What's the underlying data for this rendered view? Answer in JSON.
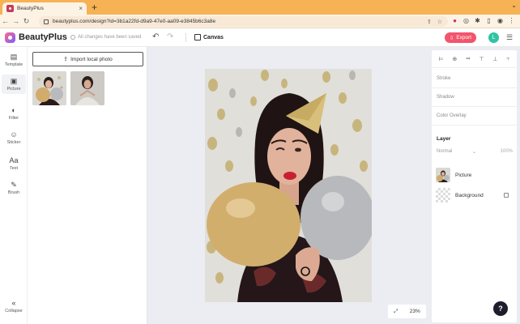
{
  "browser": {
    "tab_title": "BeautyPlus",
    "tab_close": "×",
    "new_tab": "+",
    "url": "beautyplus.com/design?id=3b1a22fd-d9a9-47e0-aa09-e3845b6c3a8e",
    "window_controls": "⌄"
  },
  "header": {
    "brand": "BeautyPlus",
    "save_status": "All changes have been saved",
    "canvas_label": "Canvas",
    "export_label": "Export",
    "avatar_letter": "L",
    "accent": "#f2556c"
  },
  "rail": {
    "items": [
      {
        "label": "Template",
        "icon": "▤"
      },
      {
        "label": "Picture",
        "icon": "▣"
      },
      {
        "label": "Filter",
        "icon": "◐"
      },
      {
        "label": "Sticker",
        "icon": "☺"
      },
      {
        "label": "Text",
        "icon": "Aa"
      },
      {
        "label": "Brush",
        "icon": "✎"
      }
    ],
    "collapse_icon": "«",
    "collapse_label": "Collapse"
  },
  "panel": {
    "import_label": "Import local photo"
  },
  "canvas": {
    "zoom": "23%",
    "fit_icon": "⤢"
  },
  "properties": {
    "align_icons": [
      "⊨",
      "⊕",
      "⫤",
      "⊤",
      "⊥",
      "⫟"
    ],
    "stroke": "Stroke",
    "shadow": "Shadow",
    "color_overlay": "Color Overlay",
    "layer_title": "Layer",
    "blend_mode": "Normal",
    "opacity": "100%",
    "layers": [
      {
        "name": "Picture"
      },
      {
        "name": "Background"
      }
    ]
  },
  "help_label": "?"
}
